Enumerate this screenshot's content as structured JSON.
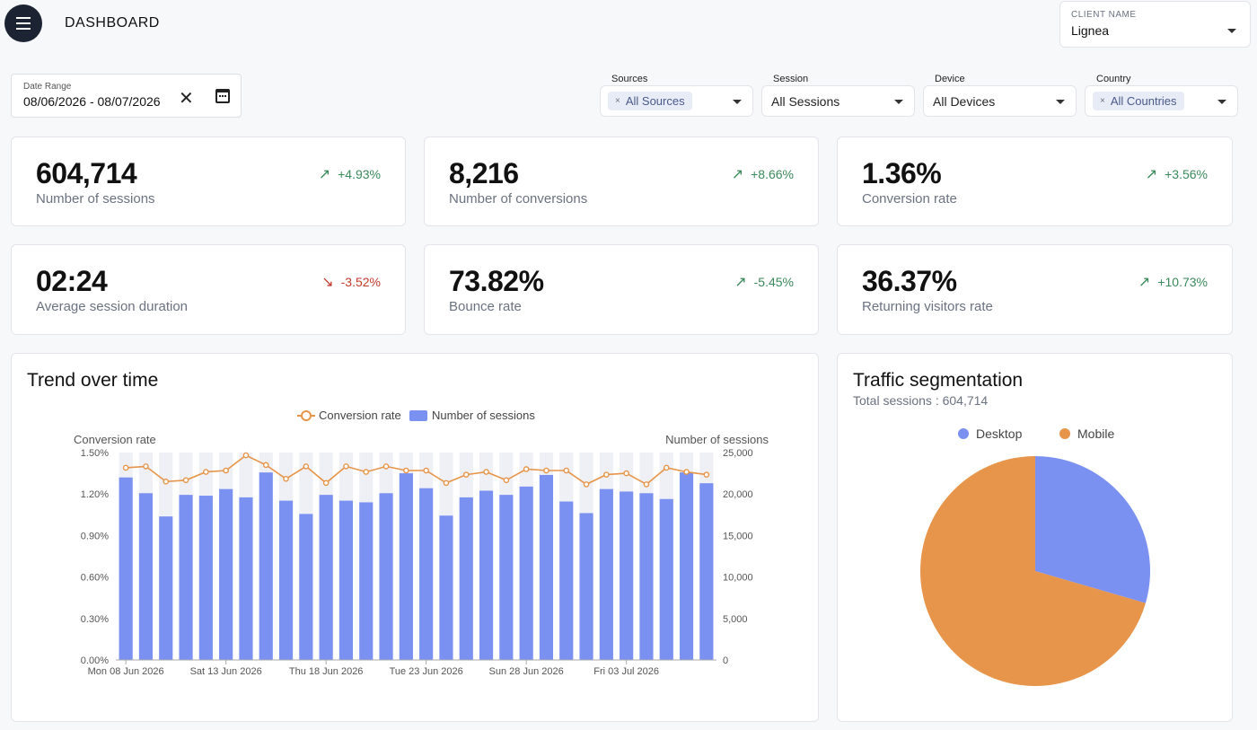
{
  "header": {
    "title": "DASHBOARD",
    "client_label": "CLIENT NAME",
    "client_value": "Lignea"
  },
  "date_range": {
    "label": "Date Range",
    "value": "08/06/2026 - 08/07/2026"
  },
  "filters": {
    "sources": {
      "label": "Sources",
      "value": "All Sources"
    },
    "session": {
      "label": "Session",
      "value": "All Sessions"
    },
    "device": {
      "label": "Device",
      "value": "All Devices"
    },
    "country": {
      "label": "Country",
      "value": "All Countries"
    }
  },
  "kpis": [
    {
      "value": "604,714",
      "label": "Number of sessions",
      "delta": "+4.93%",
      "direction": "up"
    },
    {
      "value": "8,216",
      "label": "Number of conversions",
      "delta": "+8.66%",
      "direction": "up"
    },
    {
      "value": "1.36%",
      "label": "Conversion rate",
      "delta": "+3.56%",
      "direction": "up"
    },
    {
      "value": "02:24",
      "label": "Average session duration",
      "delta": "-3.52%",
      "direction": "down"
    },
    {
      "value": "73.82%",
      "label": "Bounce rate",
      "delta": "-5.45%",
      "direction": "up"
    },
    {
      "value": "36.37%",
      "label": "Returning visitors rate",
      "delta": "+10.73%",
      "direction": "up"
    }
  ],
  "colors": {
    "bars": "#7b91f2",
    "line": "#e6954a",
    "desktop": "#7b91f2",
    "mobile": "#e6954a",
    "up": "#3a8a5a",
    "down": "#c0392b"
  },
  "trend": {
    "title": "Trend over time",
    "legend_line": "Conversion rate",
    "legend_bars": "Number of sessions",
    "left_axis_title": "Conversion rate",
    "right_axis_title": "Number of sessions",
    "left_ticks": [
      "0.00%",
      "0.30%",
      "0.60%",
      "0.90%",
      "1.20%",
      "1.50%"
    ],
    "right_ticks": [
      "0",
      "5,000",
      "10,000",
      "15,000",
      "20,000",
      "25,000"
    ],
    "x_ticks": [
      "Mon 08 Jun 2026",
      "Sat 13 Jun 2026",
      "Thu 18 Jun 2026",
      "Tue 23 Jun 2026",
      "Sun 28 Jun 2026",
      "Fri 03 Jul 2026"
    ]
  },
  "segmentation": {
    "title": "Traffic segmentation",
    "subtitle": "Total sessions : 604,714",
    "legend": [
      "Desktop",
      "Mobile"
    ]
  },
  "chart_data": [
    {
      "type": "bar",
      "title": "Trend over time",
      "x": [
        "08 Jun",
        "09 Jun",
        "10 Jun",
        "11 Jun",
        "12 Jun",
        "13 Jun",
        "14 Jun",
        "15 Jun",
        "16 Jun",
        "17 Jun",
        "18 Jun",
        "19 Jun",
        "20 Jun",
        "21 Jun",
        "22 Jun",
        "23 Jun",
        "24 Jun",
        "25 Jun",
        "26 Jun",
        "27 Jun",
        "28 Jun",
        "29 Jun",
        "30 Jun",
        "01 Jul",
        "02 Jul",
        "03 Jul",
        "04 Jul",
        "05 Jul",
        "06 Jul",
        "07 Jul"
      ],
      "series": [
        {
          "name": "Number of sessions",
          "axis": "right",
          "values": [
            22000,
            20100,
            17300,
            19900,
            19800,
            20600,
            19600,
            22600,
            19200,
            17600,
            19900,
            19200,
            19000,
            20100,
            22500,
            20700,
            17400,
            19600,
            20400,
            19900,
            20900,
            22300,
            19100,
            17700,
            20600,
            20300,
            20100,
            19400,
            22600,
            21300
          ]
        },
        {
          "name": "Conversion rate",
          "axis": "left",
          "type": "line",
          "values": [
            1.39,
            1.4,
            1.29,
            1.3,
            1.36,
            1.37,
            1.48,
            1.41,
            1.31,
            1.4,
            1.28,
            1.4,
            1.36,
            1.4,
            1.37,
            1.37,
            1.28,
            1.34,
            1.36,
            1.3,
            1.38,
            1.37,
            1.37,
            1.27,
            1.34,
            1.35,
            1.27,
            1.39,
            1.36,
            1.34
          ]
        }
      ],
      "ylim_left": [
        0,
        1.5
      ],
      "ylim_right": [
        0,
        25000
      ]
    },
    {
      "type": "pie",
      "title": "Traffic segmentation",
      "categories": [
        "Desktop",
        "Mobile"
      ],
      "values": [
        29.5,
        70.5
      ]
    }
  ]
}
